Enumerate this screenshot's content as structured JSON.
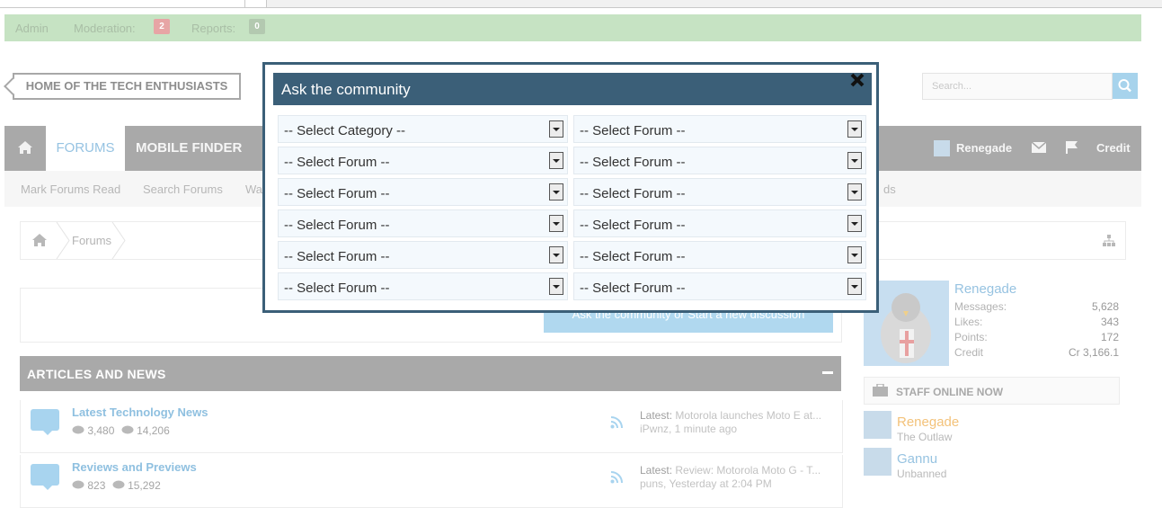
{
  "admin_bar": {
    "admin_label": "Admin",
    "moderation_label": "Moderation:",
    "moderation_count": "2",
    "reports_label": "Reports:",
    "reports_count": "0"
  },
  "header": {
    "tagline": "HOME OF THE TECH ENTHUSIASTS",
    "search_placeholder": "Search..."
  },
  "nav": {
    "tabs": [
      {
        "label": "FORUMS"
      },
      {
        "label": "MOBILE FINDER"
      }
    ],
    "user_label": "Renegade",
    "credit_label": "Credit"
  },
  "subnav": {
    "links": [
      {
        "label": "Mark Forums Read"
      },
      {
        "label": "Search Forums"
      },
      {
        "label": "Wa"
      },
      {
        "label": "ds"
      }
    ]
  },
  "breadcrumb": {
    "forums_label": "Forums"
  },
  "content": {
    "ask_button": "Ask the community or Start a new discussion"
  },
  "section": {
    "title": "ARTICLES AND NEWS"
  },
  "forums": [
    {
      "title": "Latest Technology News",
      "threads": "3,480",
      "posts": "14,206",
      "latest_label": "Latest:",
      "latest_title": "Motorola launches Moto E at...",
      "latest_meta": "iPwnz, 1 minute ago"
    },
    {
      "title": "Reviews and Previews",
      "threads": "823",
      "posts": "15,292",
      "latest_label": "Latest:",
      "latest_title": "Review: Motorola Moto G - T...",
      "latest_meta": "puns, Yesterday at 2:04 PM"
    }
  ],
  "sidebar": {
    "user_name": "Renegade",
    "stats": [
      {
        "label": "Messages:",
        "value": "5,628"
      },
      {
        "label": "Likes:",
        "value": "343"
      },
      {
        "label": "Points:",
        "value": "172"
      },
      {
        "label": "Credit",
        "value": "Cr 3,166.1"
      }
    ],
    "staff_title": "STAFF ONLINE NOW",
    "staff": [
      {
        "name": "Renegade",
        "title": "The Outlaw",
        "color": "#f3c27a"
      },
      {
        "name": "Gannu",
        "title": "Unbanned",
        "color": "#97c3e1"
      }
    ]
  },
  "modal": {
    "title": "Ask the community",
    "selects": [
      {
        "value": "-- Select Category --"
      },
      {
        "value": "-- Select Forum --"
      },
      {
        "value": "-- Select Forum --"
      },
      {
        "value": "-- Select Forum --"
      },
      {
        "value": "-- Select Forum --"
      },
      {
        "value": "-- Select Forum --"
      },
      {
        "value": "-- Select Forum --"
      },
      {
        "value": "-- Select Forum --"
      },
      {
        "value": "-- Select Forum --"
      },
      {
        "value": "-- Select Forum --"
      },
      {
        "value": "-- Select Forum --"
      },
      {
        "value": "-- Select Forum --"
      }
    ]
  },
  "colors": {
    "modal_accent": "#3b5f78",
    "link_blue": "#8fc0e0",
    "admin_green": "#c6e3c3",
    "moderation_badge": "#e7a5a5",
    "reports_badge": "#b3c9b0"
  }
}
